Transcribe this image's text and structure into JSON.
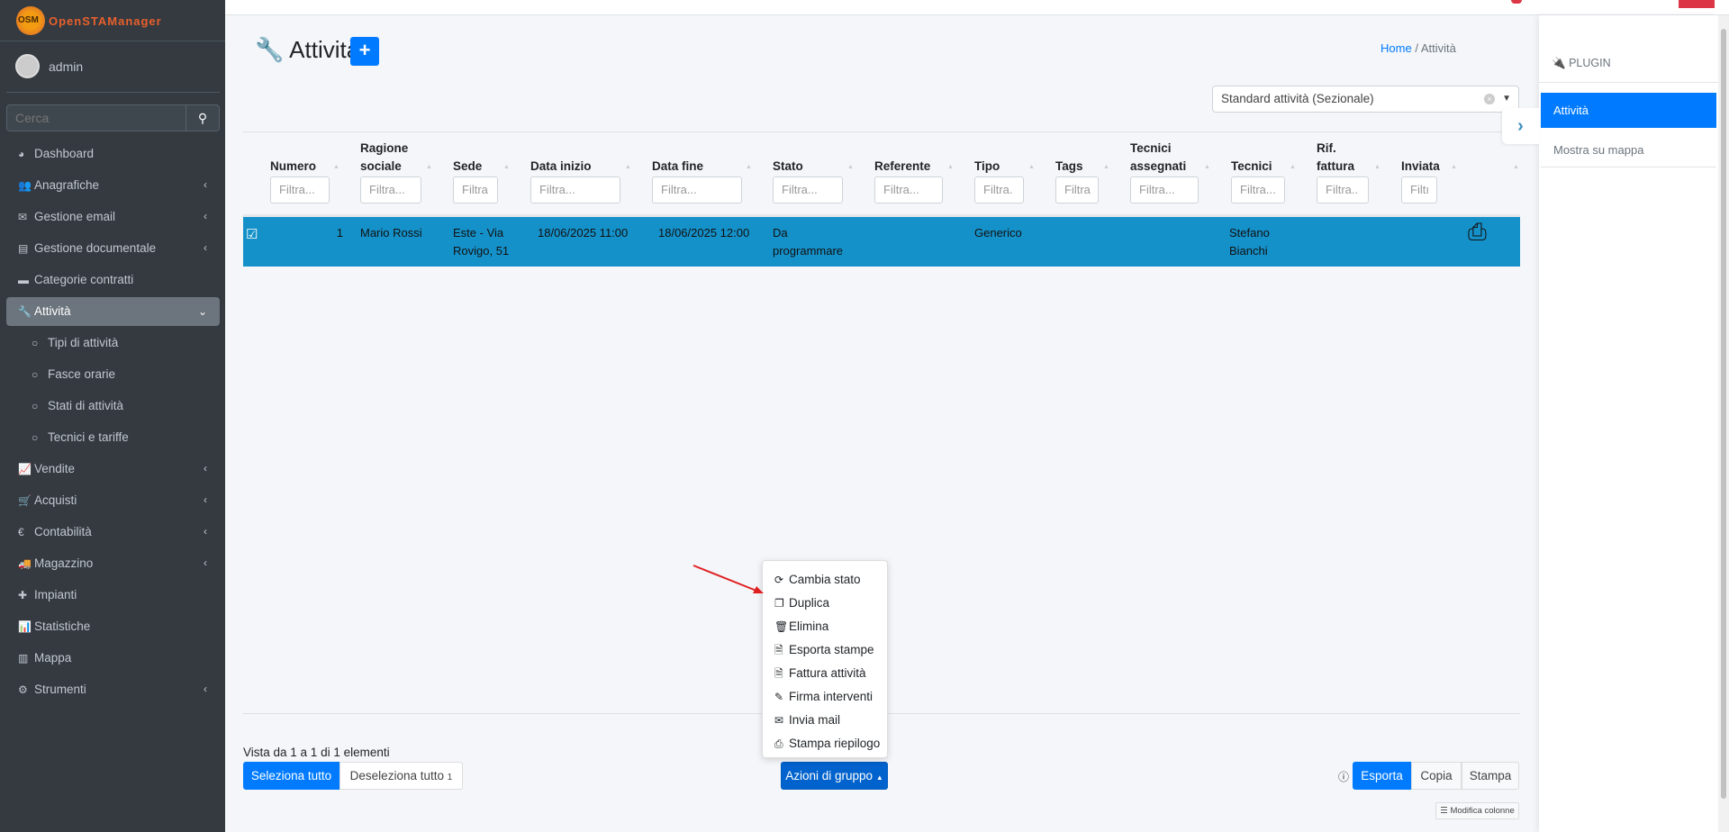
{
  "app": {
    "logo_text": "OpenSTAManager",
    "logo_badge": "OSM",
    "user": "admin",
    "search_placeholder": "Cerca"
  },
  "sidebar": {
    "items": [
      {
        "label": "Dashboard",
        "icon": "dashboard-icon",
        "glyph": "◕",
        "chevron": ""
      },
      {
        "label": "Anagrafiche",
        "icon": "users-icon",
        "glyph": "👥",
        "chevron": "‹"
      },
      {
        "label": "Gestione email",
        "icon": "envelope-icon",
        "glyph": "✉",
        "chevron": "‹"
      },
      {
        "label": "Gestione documentale",
        "icon": "document-icon",
        "glyph": "▤",
        "chevron": "‹"
      },
      {
        "label": "Categorie contratti",
        "icon": "briefcase-icon",
        "glyph": "▬",
        "chevron": ""
      },
      {
        "label": "Attività",
        "icon": "wrench-icon",
        "glyph": "🔧",
        "chevron": "⌄",
        "active": true
      },
      {
        "label": "Tipi di attività",
        "icon": "circle-icon",
        "glyph": "○",
        "sub": true
      },
      {
        "label": "Fasce orarie",
        "icon": "circle-icon",
        "glyph": "○",
        "sub": true
      },
      {
        "label": "Stati di attività",
        "icon": "circle-icon",
        "glyph": "○",
        "sub": true
      },
      {
        "label": "Tecnici e tariffe",
        "icon": "circle-icon",
        "glyph": "○",
        "sub": true
      },
      {
        "label": "Vendite",
        "icon": "line-chart-icon",
        "glyph": "📈",
        "chevron": "‹"
      },
      {
        "label": "Acquisti",
        "icon": "cart-icon",
        "glyph": "🛒",
        "chevron": "‹"
      },
      {
        "label": "Contabilità",
        "icon": "euro-icon",
        "glyph": "€",
        "chevron": "‹"
      },
      {
        "label": "Magazzino",
        "icon": "truck-icon",
        "glyph": "🚚",
        "chevron": "‹"
      },
      {
        "label": "Impianti",
        "icon": "puzzle-icon",
        "glyph": "✚",
        "chevron": ""
      },
      {
        "label": "Statistiche",
        "icon": "bar-chart-icon",
        "glyph": "📊",
        "chevron": ""
      },
      {
        "label": "Mappa",
        "icon": "map-icon",
        "glyph": "▥",
        "chevron": ""
      },
      {
        "label": "Strumenti",
        "icon": "cog-icon",
        "glyph": "⚙",
        "chevron": "‹"
      }
    ]
  },
  "header": {
    "title": "Attività",
    "add_label": "+",
    "breadcrumb_home": "Home",
    "breadcrumb_sep": "/",
    "breadcrumb_current": "Attività",
    "segment_select": "Standard attività (Sezionale)"
  },
  "table": {
    "columns": [
      {
        "l1": "",
        "l2": "Numero",
        "filter": "Filtra..."
      },
      {
        "l1": "Ragione",
        "l2": "sociale",
        "filter": "Filtra..."
      },
      {
        "l1": "",
        "l2": "Sede",
        "filter": "Filtra"
      },
      {
        "l1": "",
        "l2": "Data inizio",
        "filter": "Filtra..."
      },
      {
        "l1": "",
        "l2": "Data fine",
        "filter": "Filtra..."
      },
      {
        "l1": "",
        "l2": "Stato",
        "filter": "Filtra..."
      },
      {
        "l1": "",
        "l2": "Referente",
        "filter": "Filtra..."
      },
      {
        "l1": "",
        "l2": "Tipo",
        "filter": "Filtra."
      },
      {
        "l1": "",
        "l2": "Tags",
        "filter": "Filtra"
      },
      {
        "l1": "Tecnici",
        "l2": "assegnati",
        "filter": "Filtra..."
      },
      {
        "l1": "",
        "l2": "Tecnici",
        "filter": "Filtra..."
      },
      {
        "l1": "Rif.",
        "l2": "fattura",
        "filter": "Filtra.."
      },
      {
        "l1": "",
        "l2": "Inviata",
        "filter": "Filtı"
      }
    ],
    "rows": [
      {
        "selected": true,
        "cells": [
          "1",
          "Mario Rossi",
          "Este - Via Rovigo, 51",
          "18/06/2025 11:00",
          "18/06/2025 12:00",
          "Da programmare",
          "",
          "Generico",
          "",
          "",
          "Stefano Bianchi",
          "",
          ""
        ],
        "row_color": "#1591c9"
      }
    ]
  },
  "footer": {
    "info": "Vista da 1 a 1 di 1 elementi",
    "select_all": "Seleziona tutto",
    "deselect_all": "Deseleziona tutto",
    "selected_count": "1",
    "bulk_actions": "Azioni di gruppo",
    "export": "Esporta",
    "copy": "Copia",
    "print": "Stampa",
    "edit_columns": "Modifica colonne"
  },
  "bulk_menu": [
    {
      "label": "Cambia stato",
      "icon": "refresh-icon",
      "glyph": "⟳"
    },
    {
      "label": "Duplica",
      "icon": "copy-icon",
      "glyph": "❐"
    },
    {
      "label": "Elimina",
      "icon": "trash-icon",
      "glyph": "🗑"
    },
    {
      "label": "Esporta stampe",
      "icon": "file-pdf-icon",
      "glyph": "🗎"
    },
    {
      "label": "Fattura attività",
      "icon": "file-code-icon",
      "glyph": "🗎"
    },
    {
      "label": "Firma interventi",
      "icon": "pencil-icon",
      "glyph": "✎"
    },
    {
      "label": "Invia mail",
      "icon": "envelope-icon",
      "glyph": "✉"
    },
    {
      "label": "Stampa riepilogo",
      "icon": "print-icon",
      "glyph": "⎙"
    }
  ],
  "right_panel": {
    "heading": "PLUGIN",
    "items": [
      {
        "label": "Attività",
        "active": true
      },
      {
        "label": "Mostra su mappa"
      }
    ]
  },
  "colors": {
    "primary": "#007bff",
    "sidebar": "#343a40",
    "row_selected": "#1591c9",
    "danger": "#dc3545",
    "annotation_arrow": "#e02020"
  }
}
